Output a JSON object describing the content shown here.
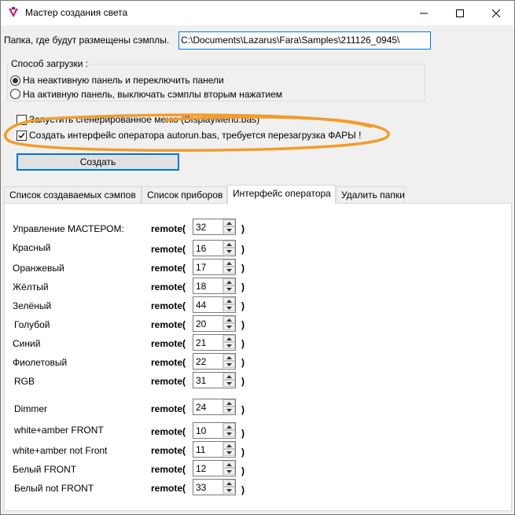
{
  "window": {
    "title": "Мастер создания света"
  },
  "folder": {
    "label": "Папка, где будут размещены сэмплы.",
    "value": "C:\\Documents\\Lazarus\\Fara\\Samples\\211126_0945\\"
  },
  "load_mode": {
    "legend": "Способ загрузки :",
    "options": [
      {
        "label": "На неактивную панель и переключить панели",
        "checked": true
      },
      {
        "label": "На активную панель, выключать сэмплы вторым нажатием",
        "checked": false
      }
    ]
  },
  "checkboxes": [
    {
      "label": "Запустить сгенерированное меню (DisplayMenu.bas)",
      "checked": false
    },
    {
      "label": "Создать интерфейс оператора autorun.bas, требуется перезагрузка ФАРЫ !",
      "checked": true
    }
  ],
  "create_button": "Создать",
  "tabs": [
    {
      "label": "Список создаваемых сэмпов",
      "active": false
    },
    {
      "label": "Список приборов",
      "active": false
    },
    {
      "label": "Интерфейс оператора",
      "active": true
    },
    {
      "label": "Удалить папки",
      "active": false
    }
  ],
  "remote_label": "remote(",
  "close_paren": ")",
  "rows": [
    {
      "label": "Управление МАСТЕРОМ:",
      "value": "32"
    },
    {
      "label": "Красный",
      "value": "16"
    },
    {
      "label": "Оранжевый",
      "value": "17"
    },
    {
      "label": "Жёлтый",
      "value": "18"
    },
    {
      "label": "Зелёный",
      "value": "44"
    },
    {
      "label": "Голубой",
      "value": "20"
    },
    {
      "label": "Синий",
      "value": "21"
    },
    {
      "label": "Фиолетовый",
      "value": "22"
    },
    {
      "label": "RGB",
      "value": "31"
    },
    {
      "label": "Dimmer",
      "value": "24"
    },
    {
      "label": "white+amber FRONT",
      "value": "10"
    },
    {
      "label": "white+amber not Front",
      "value": "11"
    },
    {
      "label": "Белый FRONT",
      "value": "12"
    },
    {
      "label": "Белый not FRONT",
      "value": "33"
    }
  ],
  "colors": {
    "accent": "#0078d7",
    "annotation": "#f39c2a"
  }
}
